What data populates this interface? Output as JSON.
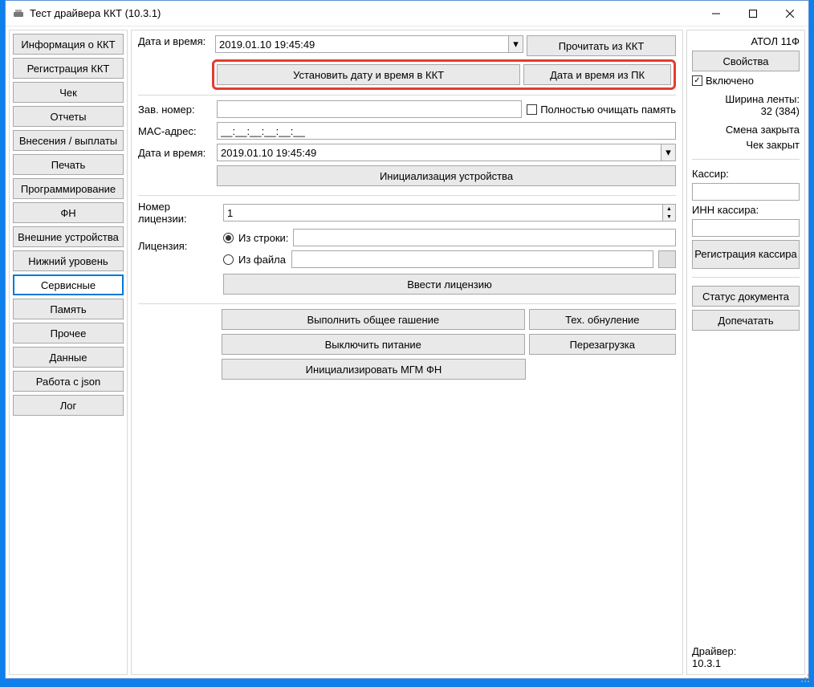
{
  "window": {
    "title": "Тест драйвера ККТ (10.3.1)"
  },
  "nav": {
    "items": [
      "Информация о ККТ",
      "Регистрация ККТ",
      "Чек",
      "Отчеты",
      "Внесения / выплаты",
      "Печать",
      "Программирование",
      "ФН",
      "Внешние устройства",
      "Нижний уровень",
      "Сервисные",
      "Память",
      "Прочее",
      "Данные",
      "Работа с json",
      "Лог"
    ],
    "active_index": 10
  },
  "center": {
    "datetime_label": "Дата и время:",
    "datetime_value": "2019.01.10 19:45:49",
    "read_from_kkt": "Прочитать из ККТ",
    "set_datetime_kkt": "Установить дату и время в ККТ",
    "datetime_from_pc": "Дата и время из ПК",
    "zav_nomer_label": "Зав. номер:",
    "zav_nomer_value": "",
    "clear_memory_label": "Полностью очищать память",
    "clear_memory_checked": false,
    "mac_label": "MAC-адрес:",
    "mac_value": "__:__:__:__:__:__",
    "datetime2_label": "Дата и время:",
    "datetime2_value": "2019.01.10 19:45:49",
    "init_device": "Инициализация устройства",
    "license_num_label": "Номер лицензии:",
    "license_num_value": "1",
    "license_label": "Лицензия:",
    "from_string": "Из строки:",
    "from_file": "Из файла",
    "from_string_value": "",
    "from_file_value": "",
    "enter_license": "Ввести лицензию",
    "common_erase": "Выполнить общее гашение",
    "tech_reset": "Тех. обнуление",
    "power_off": "Выключить питание",
    "reboot": "Перезагрузка",
    "init_mgm": "Инициализировать МГМ ФН"
  },
  "right": {
    "model": "АТОЛ 11Ф",
    "properties": "Свойства",
    "enabled_label": "Включено",
    "enabled_checked": true,
    "tape_width_label": "Ширина ленты:",
    "tape_width_value": "32 (384)",
    "shift_status": "Смена закрыта",
    "cheque_status": "Чек закрыт",
    "cashier_label": "Кассир:",
    "cashier_value": "",
    "cashier_inn_label": "ИНН кассира:",
    "cashier_inn_value": "",
    "register_cashier": "Регистрация кассира",
    "doc_status": "Статус документа",
    "reprint": "Допечатать",
    "driver_label": "Драйвер:",
    "driver_version": "10.3.1"
  }
}
